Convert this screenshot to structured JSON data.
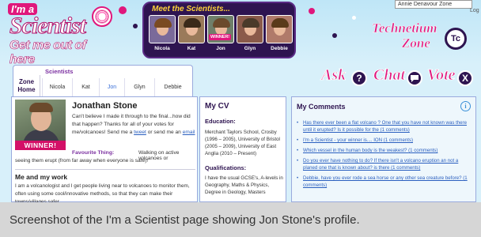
{
  "header": {
    "logo": {
      "ima": "I'm a",
      "scientist": "Scientist",
      "get_me_out": "Get me out of here"
    },
    "meet_title": "Meet the Scientists...",
    "scientists": [
      {
        "name": "Nicola",
        "hair": "#7a4a22",
        "bg": "#7a6a9a"
      },
      {
        "name": "Kat",
        "hair": "#3a2a1a",
        "bg": "#9a7a5a"
      },
      {
        "name": "Jon",
        "hair": "#6b4a2c",
        "bg": "#6f7f6a",
        "winner": "WINNER!"
      },
      {
        "name": "Glyn",
        "hair": "#4a3a2a",
        "bg": "#8a5a4a"
      },
      {
        "name": "Debbie",
        "hair": "#5a3a1a",
        "bg": "#b07a6a"
      }
    ],
    "user_select": "Annie Denavour Zone",
    "logout": "Log",
    "zone": {
      "line1": "Technetium",
      "line2": "Zone",
      "badge": "Tc"
    }
  },
  "nav": {
    "zone_home": "Zone Home",
    "scientists_label": "Scientists",
    "tabs": [
      "Nicola",
      "Kat",
      "Jon",
      "Glyn",
      "Debbie"
    ],
    "active_tab": "Jon",
    "actions": {
      "ask": "Ask",
      "ask_icon": "?",
      "chat": "Chat",
      "vote": "Vote",
      "vote_icon": "X"
    }
  },
  "profile": {
    "name": "Jonathan Stone",
    "winner_badge": "WINNER!",
    "bio_1": "Can't believe I made it through to the final...how did that happen? Thanks for all of your votes for me/volcanoes! Send me a",
    "bio_link_tweet": "tweet",
    "bio_2": "or send me an",
    "bio_link_email": "email",
    "fav_label": "Favourite Thing:",
    "fav_value_1": "Walking on active volcanoes or",
    "fav_value_2": "seeing them erupt (from far away when everyone is safe)!",
    "work_heading": "Me and my work",
    "work_text": "I am a volcanologist and I get people living near to volcanoes to monitor them, often using some cool/innovative methods, so that they can make their towns/villages safer."
  },
  "cv": {
    "title": "My CV",
    "education_heading": "Education:",
    "education_text": "Merchant Taylors School, Crosby (1996 – 2005), University of Bristol (2005 – 2009), University of East Anglia (2010 – Present)",
    "qualifications_heading": "Qualifications:",
    "qualifications_text": "I have the usual GCSE's, A-levels in Geography, Maths & Physics, Degree in Geology, Masters"
  },
  "comments": {
    "title": "My Comments",
    "items": [
      {
        "text": "Has there ever been a flat volcano ? One that you have not known was there until it erupted? Is it possible for the",
        "count": "(1 comments)"
      },
      {
        "text": "I'm a Scientist - your winner is.... ION",
        "count": "(1 comments)"
      },
      {
        "text": "Which vessel in the human body is the weakest?",
        "count": "(1 comments)"
      },
      {
        "text": "Do you ever have nothing to do? If there isn't a volcano eruption an not a planed one that is known about? is there",
        "count": "(1 comments)"
      },
      {
        "text": "Debbie, have you ever rode a sea horse or any other sea creature before?",
        "count": "(1 comments)"
      }
    ]
  },
  "caption": "Screenshot of the I'm a Scientist page showing Jon Stone's profile.",
  "colors": {
    "accent": "#e0177c",
    "navy": "#2e1450",
    "link": "#2a5fbf",
    "sky": "#d8f0fa"
  }
}
